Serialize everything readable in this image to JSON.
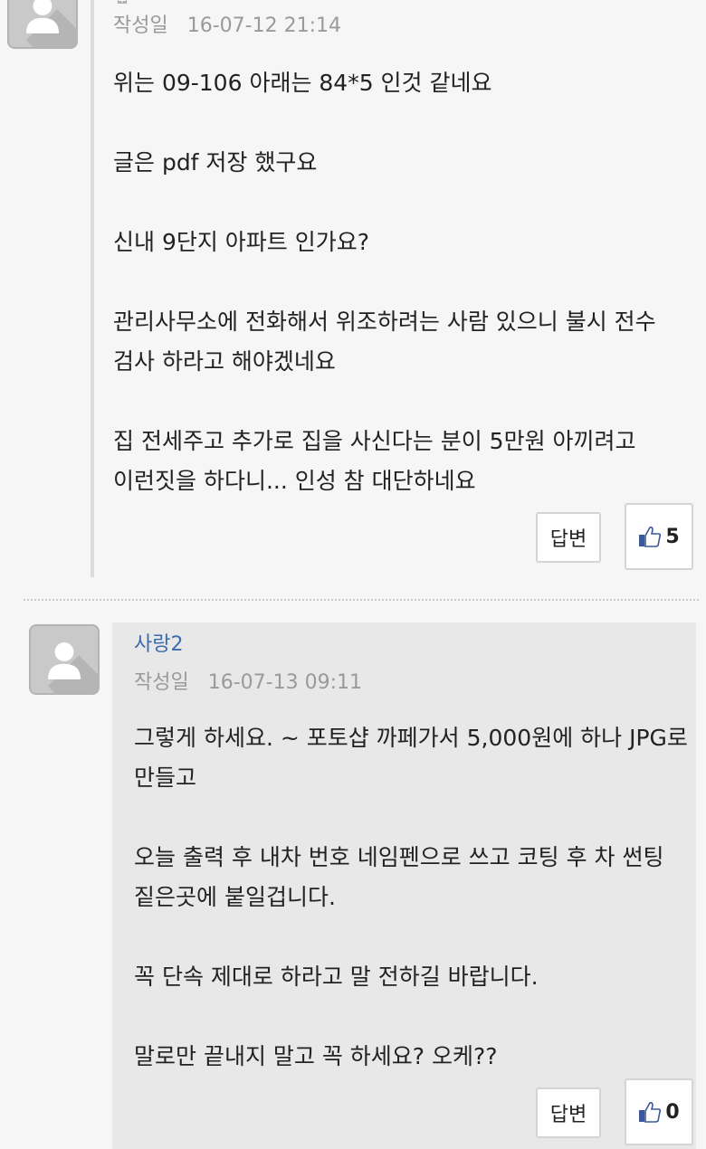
{
  "comments": [
    {
      "author": "",
      "date_label": "작성일",
      "date": "16-07-12 21:14",
      "paragraphs": [
        "위는 09-106 아래는 84*5 인것 같네요",
        "글은 pdf 저장 했구요",
        "신내 9단지 아파트 인가요?",
        "관리사무소에 전화해서 위조하려는 사람 있으니 불시 전수 검사 하라고 해야겠네요",
        "집 전세주고 추가로 집을 사신다는 분이 5만원 아끼려고 이런짓을 하다니... 인성 참 대단하네요"
      ],
      "reply_label": "답변",
      "like_count": "5"
    },
    {
      "author": "사랑2",
      "date_label": "작성일",
      "date": "16-07-13 09:11",
      "paragraphs": [
        "그렇게 하세요. ~ 포토샵 까페가서 5,000원에 하나 JPG로 만들고",
        "오늘 출력 후 내차 번호 네임펜으로 쓰고 코팅 후 차 썬팅 짙은곳에 붙일겁니다.",
        "꼭 단속 제대로 하라고 말 전하길 바랍니다.",
        "말로만 끝내지 말고 꼭 하세요? 오케??"
      ],
      "reply_label": "답변",
      "like_count": "0"
    }
  ],
  "colors": {
    "author_link": "#3a6bb0",
    "date_text": "#9a9a9a",
    "panel_bg": "#e8e8e8",
    "thumb_icon": "#3b5998"
  },
  "icons": [
    "avatar-placeholder-icon",
    "lock-icon",
    "thumbs-up-icon"
  ]
}
